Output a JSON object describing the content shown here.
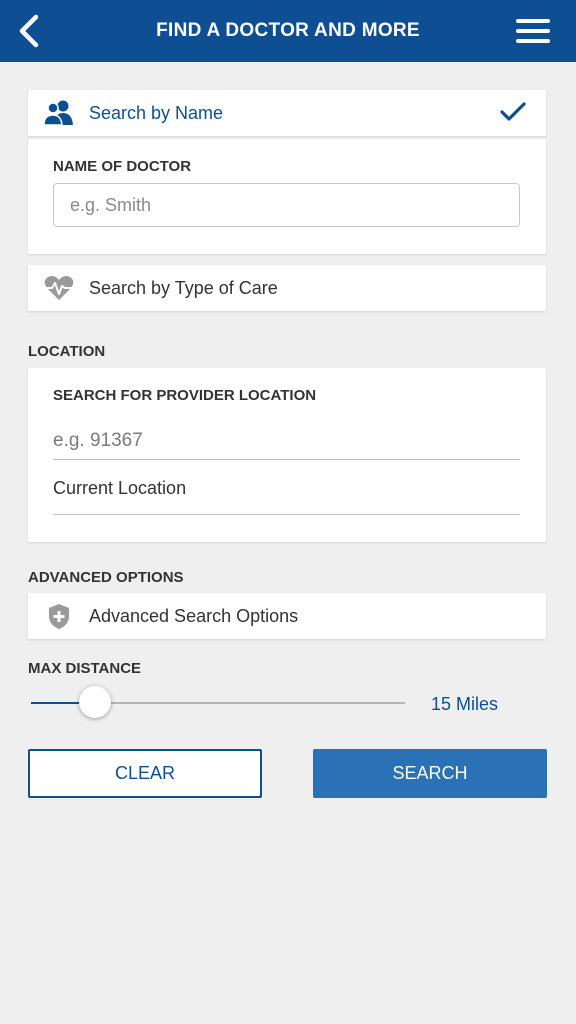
{
  "header": {
    "title": "FIND A DOCTOR AND MORE",
    "back_icon": "chevron-left-icon",
    "menu_icon": "hamburger-menu-icon"
  },
  "search_by_name": {
    "label": "Search by Name",
    "icon": "people-icon",
    "selected_icon": "checkmark-icon",
    "selected": true,
    "field_label": "NAME OF DOCTOR",
    "placeholder": "e.g. Smith",
    "value": ""
  },
  "search_by_type": {
    "label": "Search by Type of Care",
    "icon": "heartbeat-icon"
  },
  "location": {
    "section_label": "LOCATION",
    "field_label": "SEARCH FOR PROVIDER LOCATION",
    "placeholder": "e.g. 91367",
    "value": "",
    "current_location_label": "Current Location"
  },
  "advanced": {
    "section_label": "ADVANCED OPTIONS",
    "label": "Advanced Search Options",
    "icon": "shield-plus-icon"
  },
  "max_distance": {
    "section_label": "MAX DISTANCE",
    "value_label": "15 Miles",
    "slider_fraction": 0.17
  },
  "actions": {
    "clear_label": "CLEAR",
    "search_label": "SEARCH"
  },
  "colors": {
    "brand_blue": "#0d4f92",
    "button_blue": "#2a72b5",
    "background": "#efefef"
  }
}
